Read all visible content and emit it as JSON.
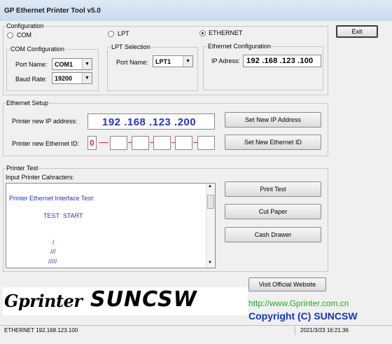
{
  "window": {
    "title": "GP Ethernet Printer Tool v5.0",
    "exit_label": "Exit"
  },
  "configuration": {
    "label": "Configuration",
    "radio_com": "COM",
    "radio_lpt": "LPT",
    "radio_ethernet": "ETHERNET",
    "selected": "ETHERNET",
    "com_group": "COM Configuration",
    "com_port_label": "Port Name:",
    "com_port_value": "COM1",
    "baud_label": "Baud Rate:",
    "baud_value": "19200",
    "lpt_group": "LPT Selection",
    "lpt_port_label": "Port Name:",
    "lpt_port_value": "LPT1",
    "eth_group": "Ethernet Configuration",
    "ip_label": "IP Adress:",
    "ip_value": "192 .168 .123 .100"
  },
  "ethernet_setup": {
    "label": "Ethernet Setup",
    "new_ip_label": "Printer new IP address:",
    "new_ip_value": "192 .168 .123 .200",
    "set_ip_button": "Set New IP Address",
    "new_id_label": "Printer new Ethernet ID:",
    "new_id_first": "0",
    "set_id_button": "Set New Ethernet ID"
  },
  "printer_test": {
    "label": "Printer Test",
    "input_label": "Input Printer Cahracters:",
    "lines": [
      "Printer Ethernet Interface Test:",
      "TEST  START",
      "/",
      "///",
      "/////"
    ],
    "print_button": "Print Test",
    "cut_button": "Cut Paper",
    "drawer_button": "Cash Drawer"
  },
  "footer": {
    "visit_button": "Visit Official Website",
    "url": "http://www.Gprinter.com.cn",
    "copyright": "Copyright (C) SUNCSW",
    "logo_text": "GprinterSUNCSW",
    "status_left": "ETHERNET 192.168.123.100",
    "status_right": "2021/3/23 16:21:36"
  },
  "colors": {
    "blue_text": "#2233cc",
    "url_green": "#22aa22",
    "copyright_blue": "#1133cc",
    "id_red": "#d33333"
  }
}
